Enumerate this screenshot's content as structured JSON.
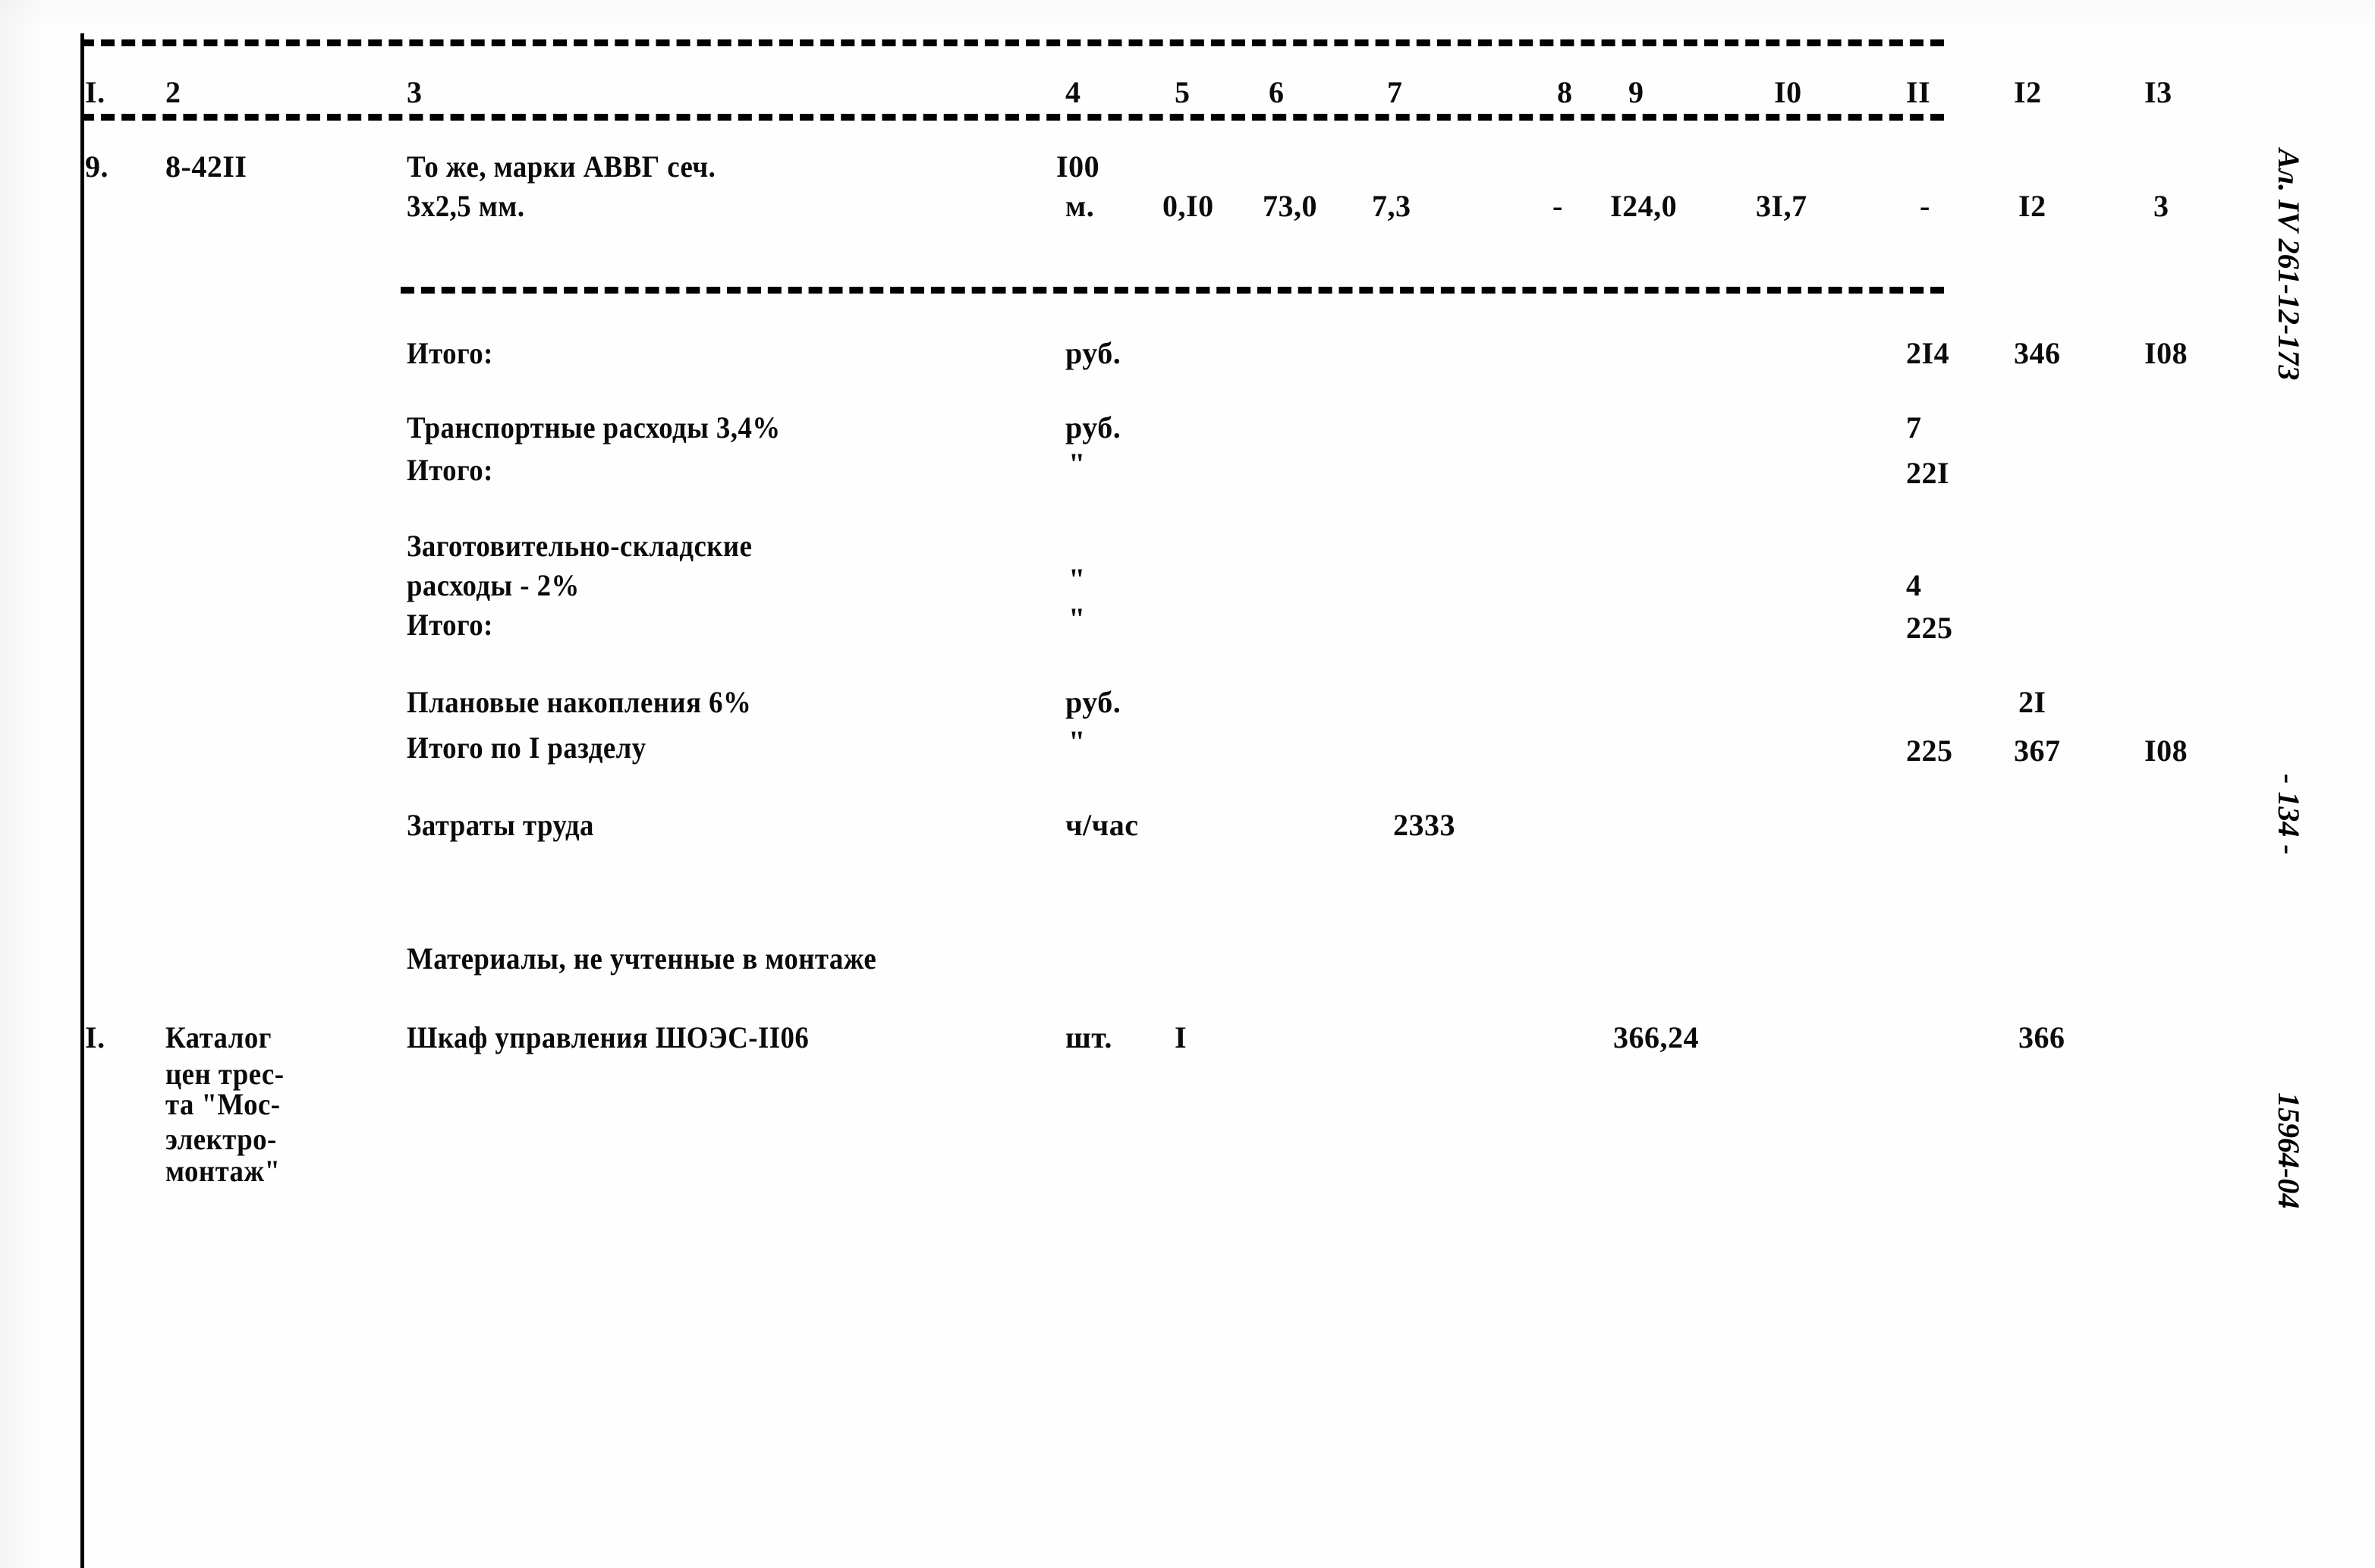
{
  "document": {
    "type": "soviet-construction-estimate-sheet",
    "language": "ru"
  },
  "table": {
    "column_numbers": [
      "I.",
      "2",
      "3",
      "4",
      "5",
      "6",
      "7",
      "8",
      "9",
      "I0",
      "II",
      "I2",
      "I3"
    ],
    "item_row": {
      "no": "9.",
      "code": "8-42II",
      "name_line1": "То же, марки АВВГ сеч.",
      "name_line2": "3х2,5 мм.",
      "unit_line1": "I00",
      "unit_line2": "м.",
      "c5": "0,I0",
      "c6": "73,0",
      "c7": "7,3",
      "c8": "-",
      "c9": "I24,0",
      "c10": "3I,7",
      "c11": "-",
      "c12": "I2",
      "c13": "3"
    },
    "summary_rows": [
      {
        "label": "Итого:",
        "unit": "руб.",
        "c11": "2I4",
        "c12": "346",
        "c13": "I08"
      },
      {
        "label": "Транспортные расходы 3,4%",
        "unit": "руб.",
        "c11": "7",
        "c12": "",
        "c13": ""
      },
      {
        "label": "Итого:",
        "unit": "\"",
        "c11": "22I",
        "c12": "",
        "c13": ""
      },
      {
        "label_line1": "Заготовительно-складские",
        "label_line2": "расходы - 2%",
        "unit": "\"",
        "c11": "4",
        "c12": "",
        "c13": ""
      },
      {
        "label": "Итого:",
        "unit": "\"",
        "c11": "225",
        "c12": "",
        "c13": ""
      },
      {
        "label": "Плановые накопления 6%",
        "unit": "руб.",
        "c11": "",
        "c12": "2I",
        "c13": ""
      },
      {
        "label": "Итого по I разделу",
        "unit": "\"",
        "c11": "225",
        "c12": "367",
        "c13": "I08"
      },
      {
        "label": "Затраты труда",
        "unit": "ч/час",
        "c7": "2333",
        "c11": "",
        "c12": "",
        "c13": ""
      }
    ],
    "section_heading": "Материалы, не учтенные в монтаже",
    "material_row": {
      "no": "I.",
      "source_line1": "Каталог",
      "source_line2": "цен трес-",
      "source_line3": "та \"Мос-",
      "source_line4": "электро-",
      "source_line5": "монтаж\"",
      "name": "Шкаф управления ШОЭС-II06",
      "unit": "шт.",
      "qty": "I",
      "c9": "366,24",
      "c12": "366"
    }
  },
  "margin_notes": {
    "archive_ref": "Ал. IV 261-12-173",
    "page_number": "- 134 -",
    "scan_id": "15964-04"
  }
}
